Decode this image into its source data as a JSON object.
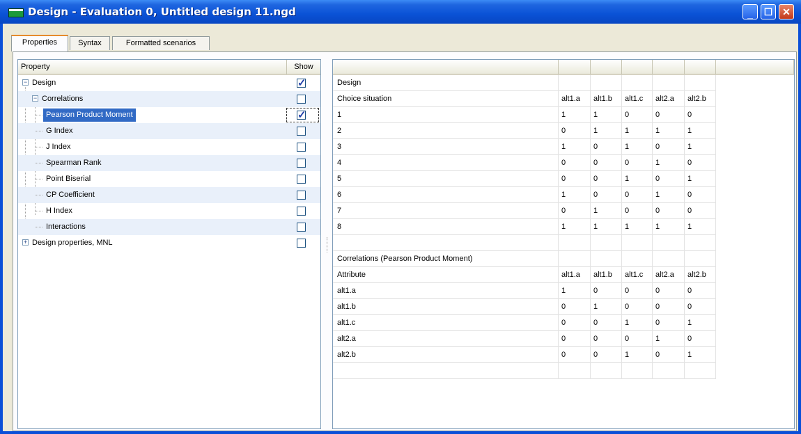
{
  "window": {
    "title": "Design  -  Evaluation 0,  Untitled design 11.ngd",
    "minimize_icon": "minimize-icon",
    "maximize_icon": "maximize-icon",
    "close_icon": "close-icon"
  },
  "tabs": [
    {
      "label": "Properties",
      "active": true
    },
    {
      "label": "Syntax",
      "active": false
    },
    {
      "label": "Formatted scenarios",
      "active": false
    }
  ],
  "tree": {
    "header_property": "Property",
    "header_show": "Show",
    "nodes": [
      {
        "label": "Design",
        "checked": true,
        "expander": "−"
      },
      {
        "label": "Correlations",
        "checked": false,
        "expander": "−"
      },
      {
        "label": "Pearson Product Moment",
        "checked": true,
        "selected": true
      },
      {
        "label": "G Index",
        "checked": false
      },
      {
        "label": "J Index",
        "checked": false
      },
      {
        "label": "Spearman Rank",
        "checked": false
      },
      {
        "label": "Point Biserial",
        "checked": false
      },
      {
        "label": "CP Coefficient",
        "checked": false
      },
      {
        "label": "H Index",
        "checked": false
      },
      {
        "label": "Interactions",
        "checked": false
      },
      {
        "label": "Design properties, MNL",
        "checked": false,
        "expander": "+"
      }
    ]
  },
  "grid": {
    "rows": [
      [
        "Design",
        "",
        "",
        "",
        "",
        ""
      ],
      [
        "Choice situation",
        "alt1.a",
        "alt1.b",
        "alt1.c",
        "alt2.a",
        "alt2.b"
      ],
      [
        "1",
        "1",
        "1",
        "0",
        "0",
        "0"
      ],
      [
        "2",
        "0",
        "1",
        "1",
        "1",
        "1"
      ],
      [
        "3",
        "1",
        "0",
        "1",
        "0",
        "1"
      ],
      [
        "4",
        "0",
        "0",
        "0",
        "1",
        "0"
      ],
      [
        "5",
        "0",
        "0",
        "1",
        "0",
        "1"
      ],
      [
        "6",
        "1",
        "0",
        "0",
        "1",
        "0"
      ],
      [
        "7",
        "0",
        "1",
        "0",
        "0",
        "0"
      ],
      [
        "8",
        "1",
        "1",
        "1",
        "1",
        "1"
      ],
      [
        "",
        "",
        "",
        "",
        "",
        ""
      ],
      [
        "Correlations (Pearson Product Moment)",
        "",
        "",
        "",
        "",
        ""
      ],
      [
        "Attribute",
        "alt1.a",
        "alt1.b",
        "alt1.c",
        "alt2.a",
        "alt2.b"
      ],
      [
        "alt1.a",
        "1",
        "0",
        "0",
        "0",
        "0"
      ],
      [
        "alt1.b",
        "0",
        "1",
        "0",
        "0",
        "0"
      ],
      [
        "alt1.c",
        "0",
        "0",
        "1",
        "0",
        "1"
      ],
      [
        "alt2.a",
        "0",
        "0",
        "0",
        "1",
        "0"
      ],
      [
        "alt2.b",
        "0",
        "0",
        "1",
        "0",
        "1"
      ],
      [
        "",
        "",
        "",
        "",
        "",
        ""
      ]
    ]
  }
}
